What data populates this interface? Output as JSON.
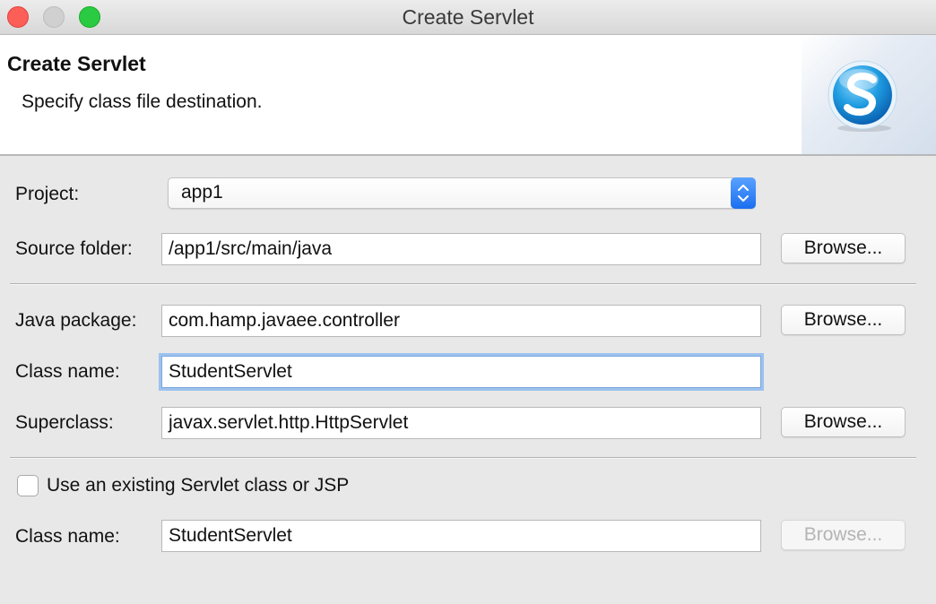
{
  "window": {
    "title": "Create Servlet",
    "controls": [
      "close",
      "minimize",
      "zoom"
    ]
  },
  "banner": {
    "title": "Create Servlet",
    "description": "Specify class file destination.",
    "logo_icon": "servlet-s-logo-icon"
  },
  "form": {
    "project": {
      "label": "Project:",
      "value": "app1"
    },
    "source_folder": {
      "label": "Source folder:",
      "value": "/app1/src/main/java",
      "browse": "Browse..."
    },
    "java_package": {
      "label": "Java package:",
      "value": "com.hamp.javaee.controller",
      "browse": "Browse..."
    },
    "class_name": {
      "label": "Class name:",
      "value": "StudentServlet"
    },
    "superclass": {
      "label": "Superclass:",
      "value": "javax.servlet.http.HttpServlet",
      "browse": "Browse..."
    },
    "use_existing": {
      "label": "Use an existing Servlet class or JSP",
      "checked": false
    },
    "existing_class_name": {
      "label": "Class name:",
      "value": "StudentServlet",
      "browse": "Browse...",
      "browse_enabled": false
    }
  },
  "colors": {
    "accent_blue": "#1a6ff0",
    "focus_ring": "#9cc2ee",
    "close_red": "#fc5f57",
    "zoom_green": "#2acb42"
  }
}
